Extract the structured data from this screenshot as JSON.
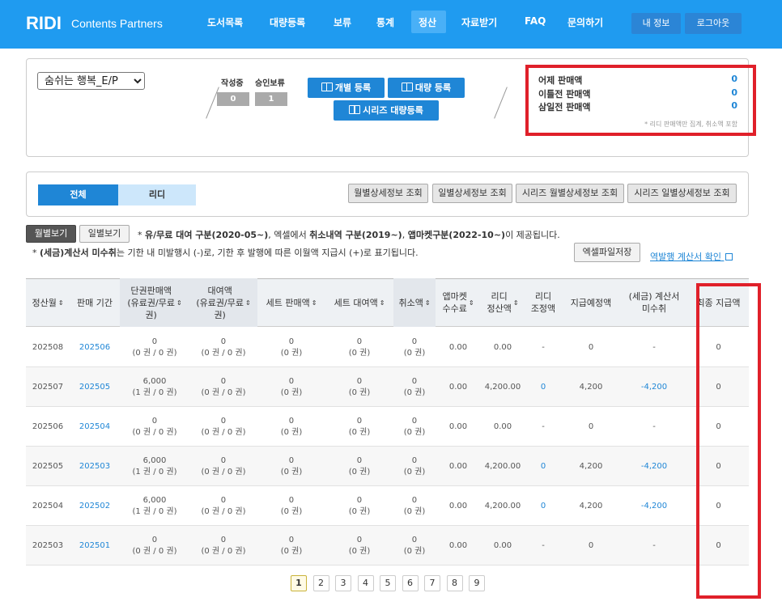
{
  "header": {
    "logo": "RIDI",
    "logo_sub": "Contents Partners",
    "nav": [
      "도서목록",
      "대량등록",
      "보류",
      "통계",
      "정산",
      "자료받기",
      "FAQ",
      "문의하기"
    ],
    "active_nav": "정산",
    "my_info": "내 정보",
    "logout": "로그아웃",
    "brand_color": "#1f9bf0"
  },
  "summary": {
    "book_select": "숨쉬는 행복_E/P",
    "writing_label": "작성중",
    "writing_value": "0",
    "pending_label": "승인보류",
    "pending_value": "1",
    "btn_single": "개별 등록",
    "btn_bulk": "대량 등록",
    "btn_series": "시리즈 대량등록",
    "sales": [
      {
        "label": "어제 판매액",
        "value": "0"
      },
      {
        "label": "이틀전 판매액",
        "value": "0"
      },
      {
        "label": "삼일전 판매액",
        "value": "0"
      }
    ],
    "note": "* 리디 판매액만 집계, 취소액 포함"
  },
  "filters": {
    "tab_all": "전체",
    "tab_ridi": "리디",
    "buttons": [
      "월별상세정보 조회",
      "일별상세정보 조회",
      "시리즈 월별상세정보 조회",
      "시리즈 일별상세정보 조회"
    ],
    "monthly": "월별보기",
    "daily": "일별보기",
    "notice1_prefix": "* ",
    "notice1_b1": "유/무료 대여 구분(2020-05~)",
    "notice1_mid1": ", 엑셀에서 ",
    "notice1_b2": "취소내역 구분(2019~)",
    "notice1_mid2": ", ",
    "notice1_b3": "앱마켓구분(2022-10~)",
    "notice1_suffix": "이 제공됩니다.",
    "notice2_prefix": "* ",
    "notice2_b": "(세금)계산서 미수취",
    "notice2_rest": "는 기한 내 미발행시 (-)로, 기한 후 발행에 따른 이월액 지급시 (+)로 표기됩니다.",
    "excel": "엑셀파일저장",
    "tax_link": "역발행 계산서 확인"
  },
  "table": {
    "headers": [
      "정산월",
      "판매 기간",
      "단권판매액\n(유료권/무료\n권)",
      "대여액\n(유료권/무료\n권)",
      "세트 판매액",
      "세트 대여액",
      "취소액",
      "앱마켓\n수수료",
      "리디\n정산액",
      "리디\n조정액",
      "지급예정액",
      "(세금) 계산서\n미수취",
      "최종 지급액"
    ],
    "rows": [
      [
        "202508",
        "202506",
        "0",
        "(0 권 / 0 권)",
        "0",
        "(0 권 / 0 권)",
        "0",
        "(0 권)",
        "0",
        "(0 권)",
        "0",
        "(0 권)",
        "0.00",
        "0.00",
        "-",
        "0",
        "-",
        "0"
      ],
      [
        "202507",
        "202505",
        "6,000",
        "(1 권 / 0 권)",
        "0",
        "(0 권 / 0 권)",
        "0",
        "(0 권)",
        "0",
        "(0 권)",
        "0",
        "(0 권)",
        "0.00",
        "4,200.00",
        "0",
        "4,200",
        "-4,200",
        "0"
      ],
      [
        "202506",
        "202504",
        "0",
        "(0 권 / 0 권)",
        "0",
        "(0 권 / 0 권)",
        "0",
        "(0 권)",
        "0",
        "(0 권)",
        "0",
        "(0 권)",
        "0.00",
        "0.00",
        "-",
        "0",
        "-",
        "0"
      ],
      [
        "202505",
        "202503",
        "6,000",
        "(1 권 / 0 권)",
        "0",
        "(0 권 / 0 권)",
        "0",
        "(0 권)",
        "0",
        "(0 권)",
        "0",
        "(0 권)",
        "0.00",
        "4,200.00",
        "0",
        "4,200",
        "-4,200",
        "0"
      ],
      [
        "202504",
        "202502",
        "6,000",
        "(1 권 / 0 권)",
        "0",
        "(0 권 / 0 권)",
        "0",
        "(0 권)",
        "0",
        "(0 권)",
        "0",
        "(0 권)",
        "0.00",
        "4,200.00",
        "0",
        "4,200",
        "-4,200",
        "0"
      ],
      [
        "202503",
        "202501",
        "0",
        "(0 권 / 0 권)",
        "0",
        "(0 권 / 0 권)",
        "0",
        "(0 권)",
        "0",
        "(0 권)",
        "0",
        "(0 권)",
        "0.00",
        "0.00",
        "-",
        "0",
        "-",
        "0"
      ]
    ]
  },
  "pagination": [
    "1",
    "2",
    "3",
    "4",
    "5",
    "6",
    "7",
    "8",
    "9"
  ],
  "active_page": "1"
}
